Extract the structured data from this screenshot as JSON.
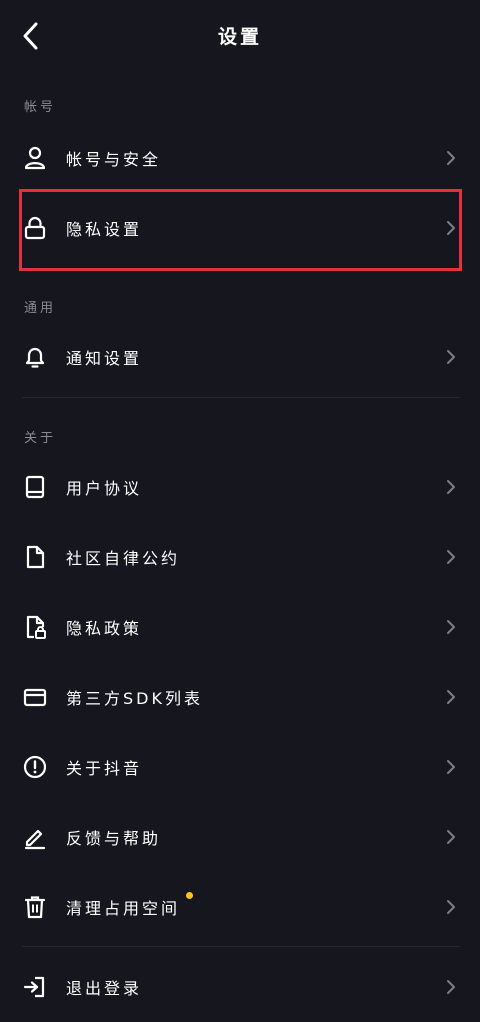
{
  "header": {
    "title": "设置"
  },
  "sections": {
    "account": {
      "label": "帐号"
    },
    "general": {
      "label": "通用"
    },
    "about": {
      "label": "关于"
    }
  },
  "rows": {
    "account_security": "帐号与安全",
    "privacy_settings": "隐私设置",
    "notification_settings": "通知设置",
    "user_agreement": "用户协议",
    "community_guidelines": "社区自律公约",
    "privacy_policy": "隐私政策",
    "sdk_list": "第三方SDK列表",
    "about_douyin": "关于抖音",
    "feedback_help": "反馈与帮助",
    "clear_storage": "清理占用空间",
    "logout": "退出登录"
  },
  "colors": {
    "background": "#16161e",
    "highlight_border": "#e0313c",
    "notification_dot": "#f5c518",
    "section_label": "#8a8b93"
  }
}
